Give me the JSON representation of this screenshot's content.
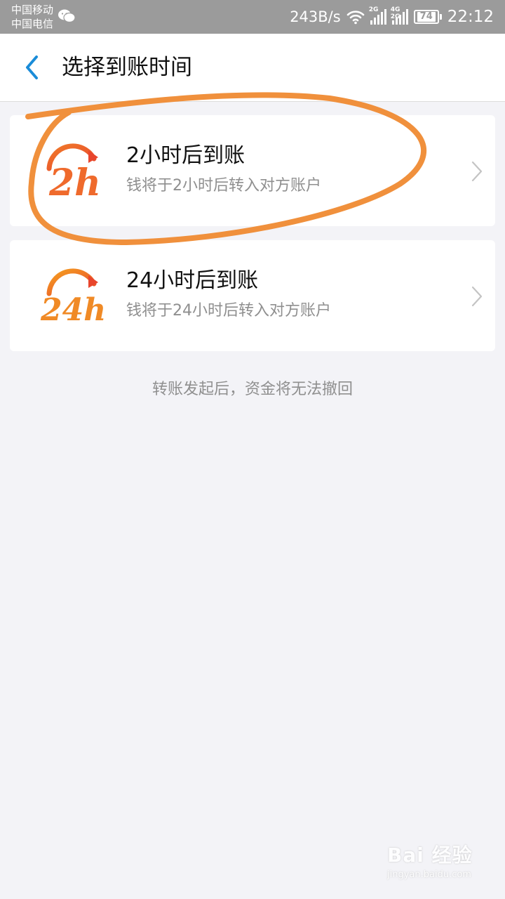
{
  "status_bar": {
    "carrier_1": "中国移动",
    "carrier_2": "中国电信",
    "net_speed": "243B/s",
    "sim1_tag": "2G",
    "sim2_tag": "4G 2G",
    "battery": "74",
    "time": "22:12"
  },
  "header": {
    "title": "选择到账时间"
  },
  "options": [
    {
      "icon_text": "2h",
      "title": "2小时后到账",
      "subtitle": "钱将于2小时后转入对方账户"
    },
    {
      "icon_text": "24h",
      "title": "24小时后到账",
      "subtitle": "钱将于24小时后转入对方账户"
    }
  ],
  "notice": "转账发起后，资金将无法撤回",
  "watermark": {
    "brand": "Bai 经验",
    "url": "jingyan.baidu.com"
  },
  "colors": {
    "status_bar_bg": "#9b9b9b",
    "accent_blue": "#1a8cd8",
    "icon_red": "#e8452c",
    "icon_orange": "#f5a020",
    "annotation_orange": "#f0903c",
    "page_bg": "#f3f3f7"
  }
}
